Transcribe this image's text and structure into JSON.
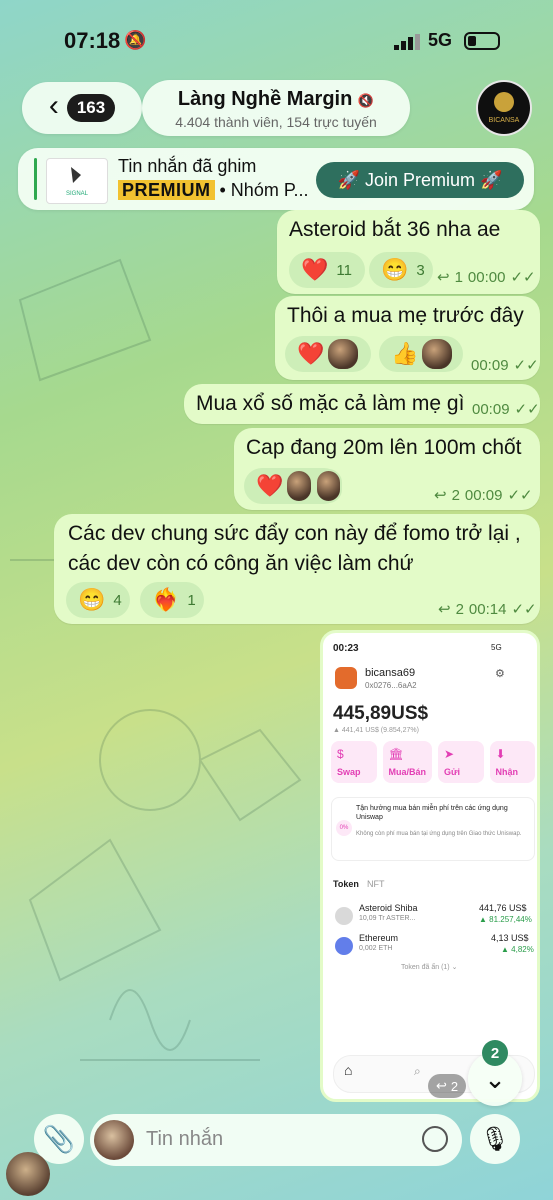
{
  "status": {
    "time": "07:18",
    "network": "5G"
  },
  "header": {
    "back_count": "163",
    "title": "Làng Nghề Margin",
    "subtitle": "4.404 thành viên, 154 trực tuyến",
    "avatar_text": "BICANSA"
  },
  "pinned": {
    "label": "Tin nhắn đã ghim",
    "tag": "PREMIUM",
    "preview": " • Nhóm P...",
    "thumb_text": "SIGNAL",
    "join_label": "🚀 Join Premium 🚀"
  },
  "messages": [
    {
      "text": "Asteroid bắt 36 nha ae",
      "time": "00:00",
      "replies": "1",
      "reactions": [
        {
          "emoji": "❤️",
          "count": "11"
        },
        {
          "emoji": "😁",
          "count": "3"
        }
      ]
    },
    {
      "text": "Thôi a mua mẹ trước đây",
      "time": "00:09",
      "reactions": [
        {
          "emoji": "❤️"
        },
        {
          "emoji": "👍"
        }
      ]
    },
    {
      "text": "Mua xổ số mặc cả làm mẹ gì",
      "time": "00:09"
    },
    {
      "text": "Cap đang 20m lên 100m chốt",
      "time": "00:09",
      "replies": "2",
      "reactions": [
        {
          "emoji": "❤️"
        }
      ]
    },
    {
      "text_line1": "Các dev chung sức đẩy con này để fomo trở lại ,",
      "text_line2": "các dev còn có công ăn việc làm chứ",
      "time": "00:14",
      "replies": "2",
      "reactions": [
        {
          "emoji": "😁",
          "count": "4"
        },
        {
          "emoji": "❤️‍🔥",
          "count": "1"
        }
      ]
    }
  ],
  "screenshot": {
    "time": "00:23",
    "net": "5G",
    "account": "bicansa69",
    "address": "0x0276...6aA2",
    "balance": "445,89US$",
    "change": "▲ 441,41 US$ (9.854,27%)",
    "actions": [
      {
        "icon": "$",
        "label": "Swap"
      },
      {
        "icon": "🏛",
        "label": "Mua/Bán"
      },
      {
        "icon": "➤",
        "label": "Gửi"
      },
      {
        "icon": "⬇",
        "label": "Nhận"
      }
    ],
    "promo_title": "Tận hưởng mua bán miễn phí trên các ứng dụng Uniswap",
    "promo_body": "Không còn phí mua bán tại ứng dụng trên Giao thức Uniswap.",
    "promo_pct": "0%",
    "tab_token": "Token",
    "tab_nft": "NFT",
    "tokens": [
      {
        "name": "Asteroid Shiba",
        "sub": "10,09 Tr ASTER...",
        "value": "441,76 US$",
        "change": "▲ 81.257,44%"
      },
      {
        "name": "Ethereum",
        "sub": "0,002 ETH",
        "value": "4,13 US$",
        "change": "▲ 4,82%"
      }
    ],
    "hidden": "Token đã ẩn (1) ⌄",
    "reply_count": "2"
  },
  "scroll_badge": "2",
  "composer": {
    "placeholder": "Tin nhắn"
  },
  "colors": {
    "bubble": "#e3fbc8",
    "meta": "#4f8a40",
    "join": "#2e6f5e"
  }
}
